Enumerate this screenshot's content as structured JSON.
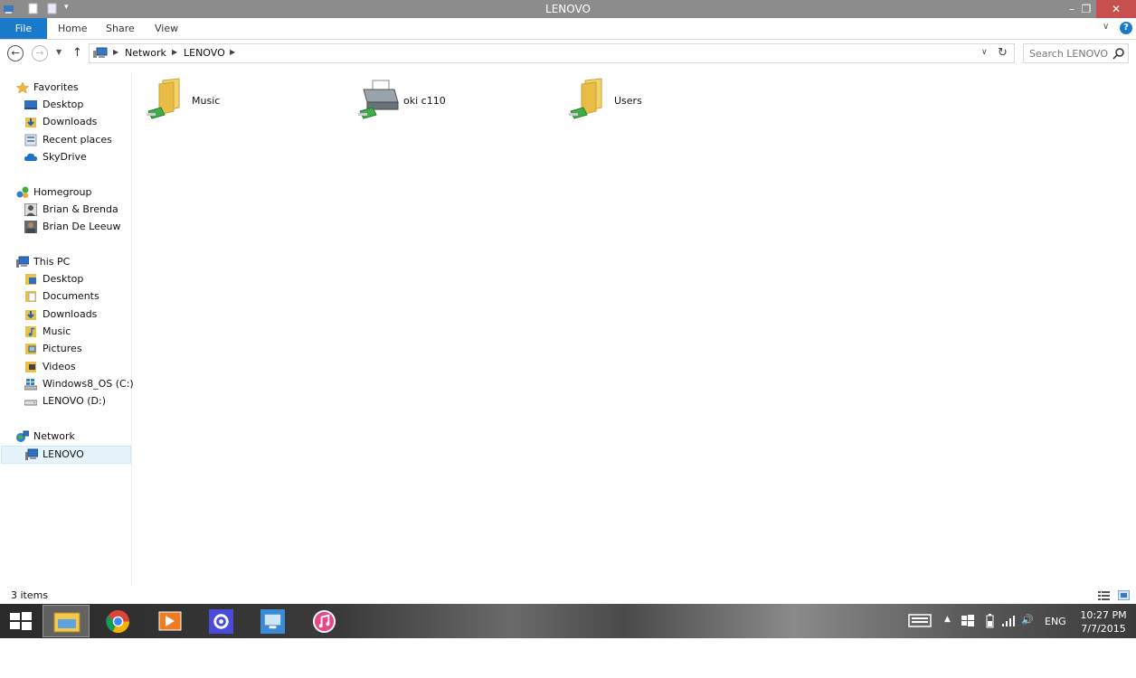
{
  "window": {
    "title": "LENOVO"
  },
  "ribbon": {
    "tabs": [
      "File",
      "Home",
      "Share",
      "View"
    ]
  },
  "address": {
    "crumbs": [
      "Network",
      "LENOVO"
    ],
    "search_placeholder": "Search LENOVO"
  },
  "nav": {
    "favorites": {
      "label": "Favorites",
      "items": [
        "Desktop",
        "Downloads",
        "Recent places",
        "SkyDrive"
      ]
    },
    "homegroup": {
      "label": "Homegroup",
      "items": [
        "Brian & Brenda",
        "Brian De Leeuw"
      ]
    },
    "thispc": {
      "label": "This PC",
      "items": [
        "Desktop",
        "Documents",
        "Downloads",
        "Music",
        "Pictures",
        "Videos",
        "Windows8_OS (C:)",
        "LENOVO (D:)"
      ]
    },
    "network": {
      "label": "Network",
      "items": [
        "LENOVO"
      ]
    }
  },
  "content": {
    "items": [
      {
        "name": "Music",
        "type": "shared-folder"
      },
      {
        "name": "oki c110",
        "type": "printer"
      },
      {
        "name": "Users",
        "type": "shared-folder"
      }
    ]
  },
  "status": {
    "count": "3 items"
  },
  "taskbar": {
    "apps": [
      "start",
      "file-explorer",
      "chrome",
      "media-player",
      "settings",
      "remote-desktop",
      "itunes"
    ],
    "tray": {
      "language": "ENG",
      "time": "10:27 PM",
      "date": "7/7/2015"
    }
  },
  "colors": {
    "accent": "#1979ca",
    "close": "#c7504f",
    "titlebar": "#8c8c8c",
    "selection": "#e5f3fb"
  }
}
